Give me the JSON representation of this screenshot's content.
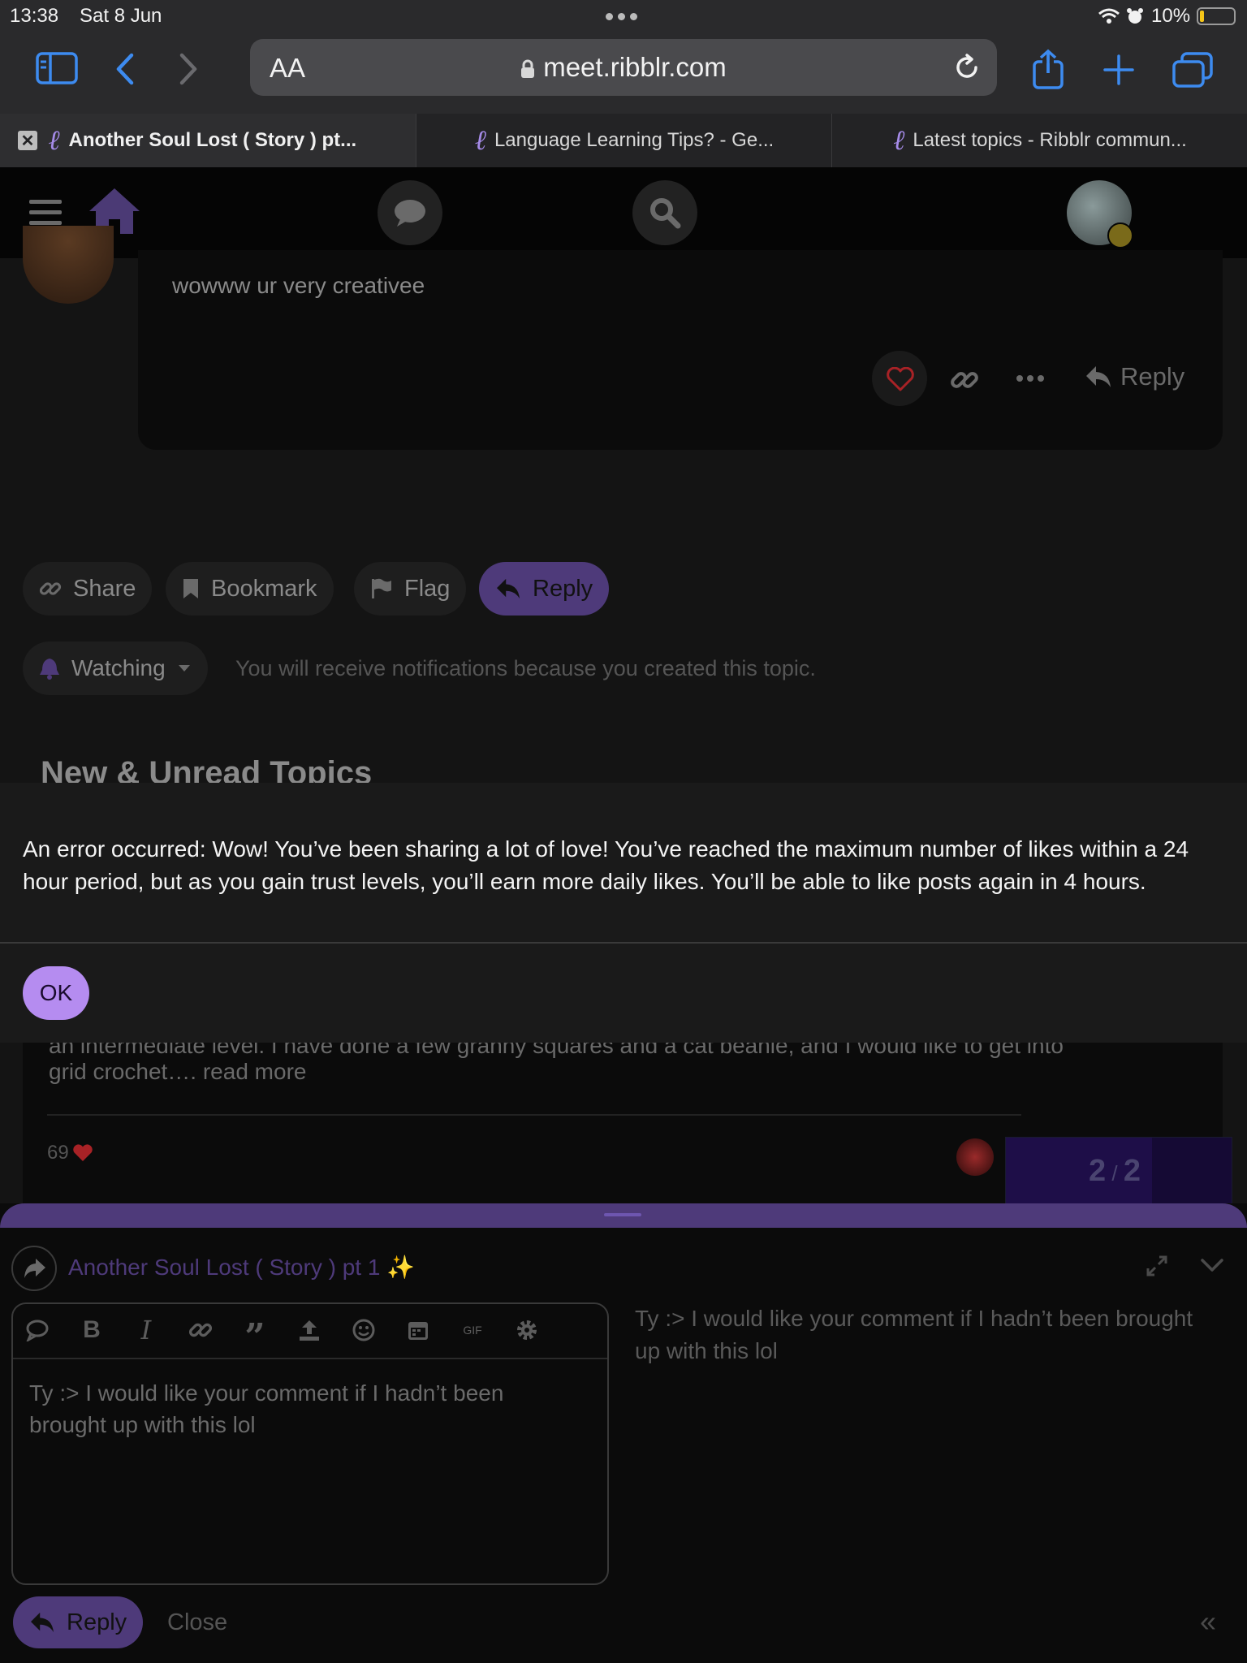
{
  "status_bar": {
    "time": "13:38",
    "date": "Sat 8 Jun",
    "battery": "10%"
  },
  "safari": {
    "text_size_label": "AA",
    "url": "meet.ribblr.com",
    "tabs": [
      {
        "title": "Another Soul Lost ( Story ) pt...",
        "active": true
      },
      {
        "title": "Language Learning Tips? - Ge...",
        "active": false
      },
      {
        "title": "Latest topics - Ribblr commun...",
        "active": false
      }
    ]
  },
  "post": {
    "text": "wowww ur very creativee",
    "reply_label": "Reply"
  },
  "topic_actions": {
    "share": "Share",
    "bookmark": "Bookmark",
    "flag": "Flag",
    "reply": "Reply"
  },
  "notifications": {
    "level": "Watching",
    "description": "You will receive notifications because you created this topic."
  },
  "suggested": {
    "heading": "New & Unread Topics",
    "excerpt_line1": "an intermediate level. I have done a few granny squares and a cat beanie, and I would like to get into",
    "excerpt_line2": "grid crochet…. read more",
    "likes": "69"
  },
  "progress": {
    "current": "2",
    "total": "2"
  },
  "modal": {
    "message": "An error occurred: Wow! You’ve been sharing a lot of love! You’ve reached the maximum number of likes within a 24 hour period, but as you gain trust levels, you’ll earn more daily likes. You’ll be able to like posts again in 4 hours.",
    "ok_label": "OK"
  },
  "composer": {
    "topic_title": "Another Soul Lost ( Story ) pt 1 ✨",
    "toolbar_gif": "GIF",
    "editor_text": "Ty :> I would like your comment if I hadn’t been brought up with this lol",
    "preview_text": "Ty :> I would like your comment if I hadn’t been brought up with this lol",
    "reply_label": "Reply",
    "close_label": "Close"
  },
  "colors": {
    "accent": "#b58cf0",
    "reply_pill": "#4e3a7a",
    "like_heart": "#c0282e",
    "safari_blue": "#3d8bf0",
    "battery_yellow": "#f5c518"
  },
  "icons": [
    "sidebar-icon",
    "back-icon",
    "forward-icon",
    "lock-icon",
    "reload-icon",
    "share-icon",
    "new-tab-icon",
    "tabs-icon",
    "hamburger-icon",
    "home-icon",
    "chat-icon",
    "search-icon",
    "heart-icon",
    "link-icon",
    "more-icon",
    "reply-icon",
    "bookmark-icon",
    "flag-icon",
    "bell-icon",
    "caret-down-icon",
    "expand-icon",
    "collapse-icon"
  ]
}
